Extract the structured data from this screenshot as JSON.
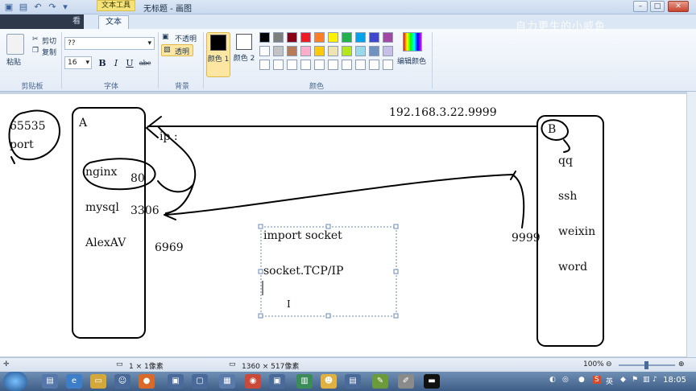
{
  "titlebar": {
    "context_tab": "文本工具",
    "title": "无标题 - 画图",
    "watermark": "自力更生的小威鱼",
    "min": "–",
    "max": "□",
    "close": "✕"
  },
  "tabs": {
    "view_partial": "看",
    "text": "文本"
  },
  "clipboard": {
    "paste": "粘贴",
    "cut": "剪切",
    "copy": "复制",
    "label": "剪贴板"
  },
  "font": {
    "family": "??",
    "size": "16",
    "bold": "B",
    "italic": "I",
    "underline": "U",
    "strike": "abc",
    "label": "字体"
  },
  "background": {
    "opaque": "不透明",
    "transparent": "透明",
    "label": "背景"
  },
  "colors": {
    "color1": "颜色 1",
    "color1_value": "#000000",
    "color2": "颜色 2",
    "color2_value": "#ffffff",
    "edit": "编辑颜色",
    "label": "颜色",
    "palette_row1": [
      "#000000",
      "#7f7f7f",
      "#880015",
      "#ed1c24",
      "#ff7f27",
      "#fff200",
      "#22b14c",
      "#00a2e8",
      "#3f48cc",
      "#a349a4"
    ],
    "palette_row2": [
      "#ffffff",
      "#c3c3c3",
      "#b97a57",
      "#ffaec9",
      "#ffc90e",
      "#efe4b0",
      "#b5e61d",
      "#99d9ea",
      "#7092be",
      "#c8bfe7"
    ],
    "palette_row3": [
      "#ffffff",
      "#ffffff",
      "#ffffff",
      "#ffffff",
      "#ffffff",
      "#ffffff",
      "#ffffff",
      "#ffffff",
      "#ffffff",
      "#ffffff"
    ]
  },
  "canvas": {
    "port_max": "65535",
    "port_word": "port",
    "host_a": "A",
    "ip_label": "ip :",
    "address": "192.168.3.22.9999",
    "host_b": "B",
    "a_items": [
      "nginx",
      "mysql",
      "AlexAV"
    ],
    "a_ports": [
      "80",
      "3306",
      "6969"
    ],
    "b_items": [
      "qq",
      "ssh",
      "weixin",
      "word"
    ],
    "b_port": "9999",
    "code_line1": "import socket",
    "code_line2": "socket.TCP/IP",
    "cursor_glyph": "I"
  },
  "status": {
    "cursor": "1 × 1像素",
    "size": "1360 × 517像素",
    "zoom": "100%"
  },
  "taskbar": {
    "lang": "英",
    "clock": "18:05"
  }
}
